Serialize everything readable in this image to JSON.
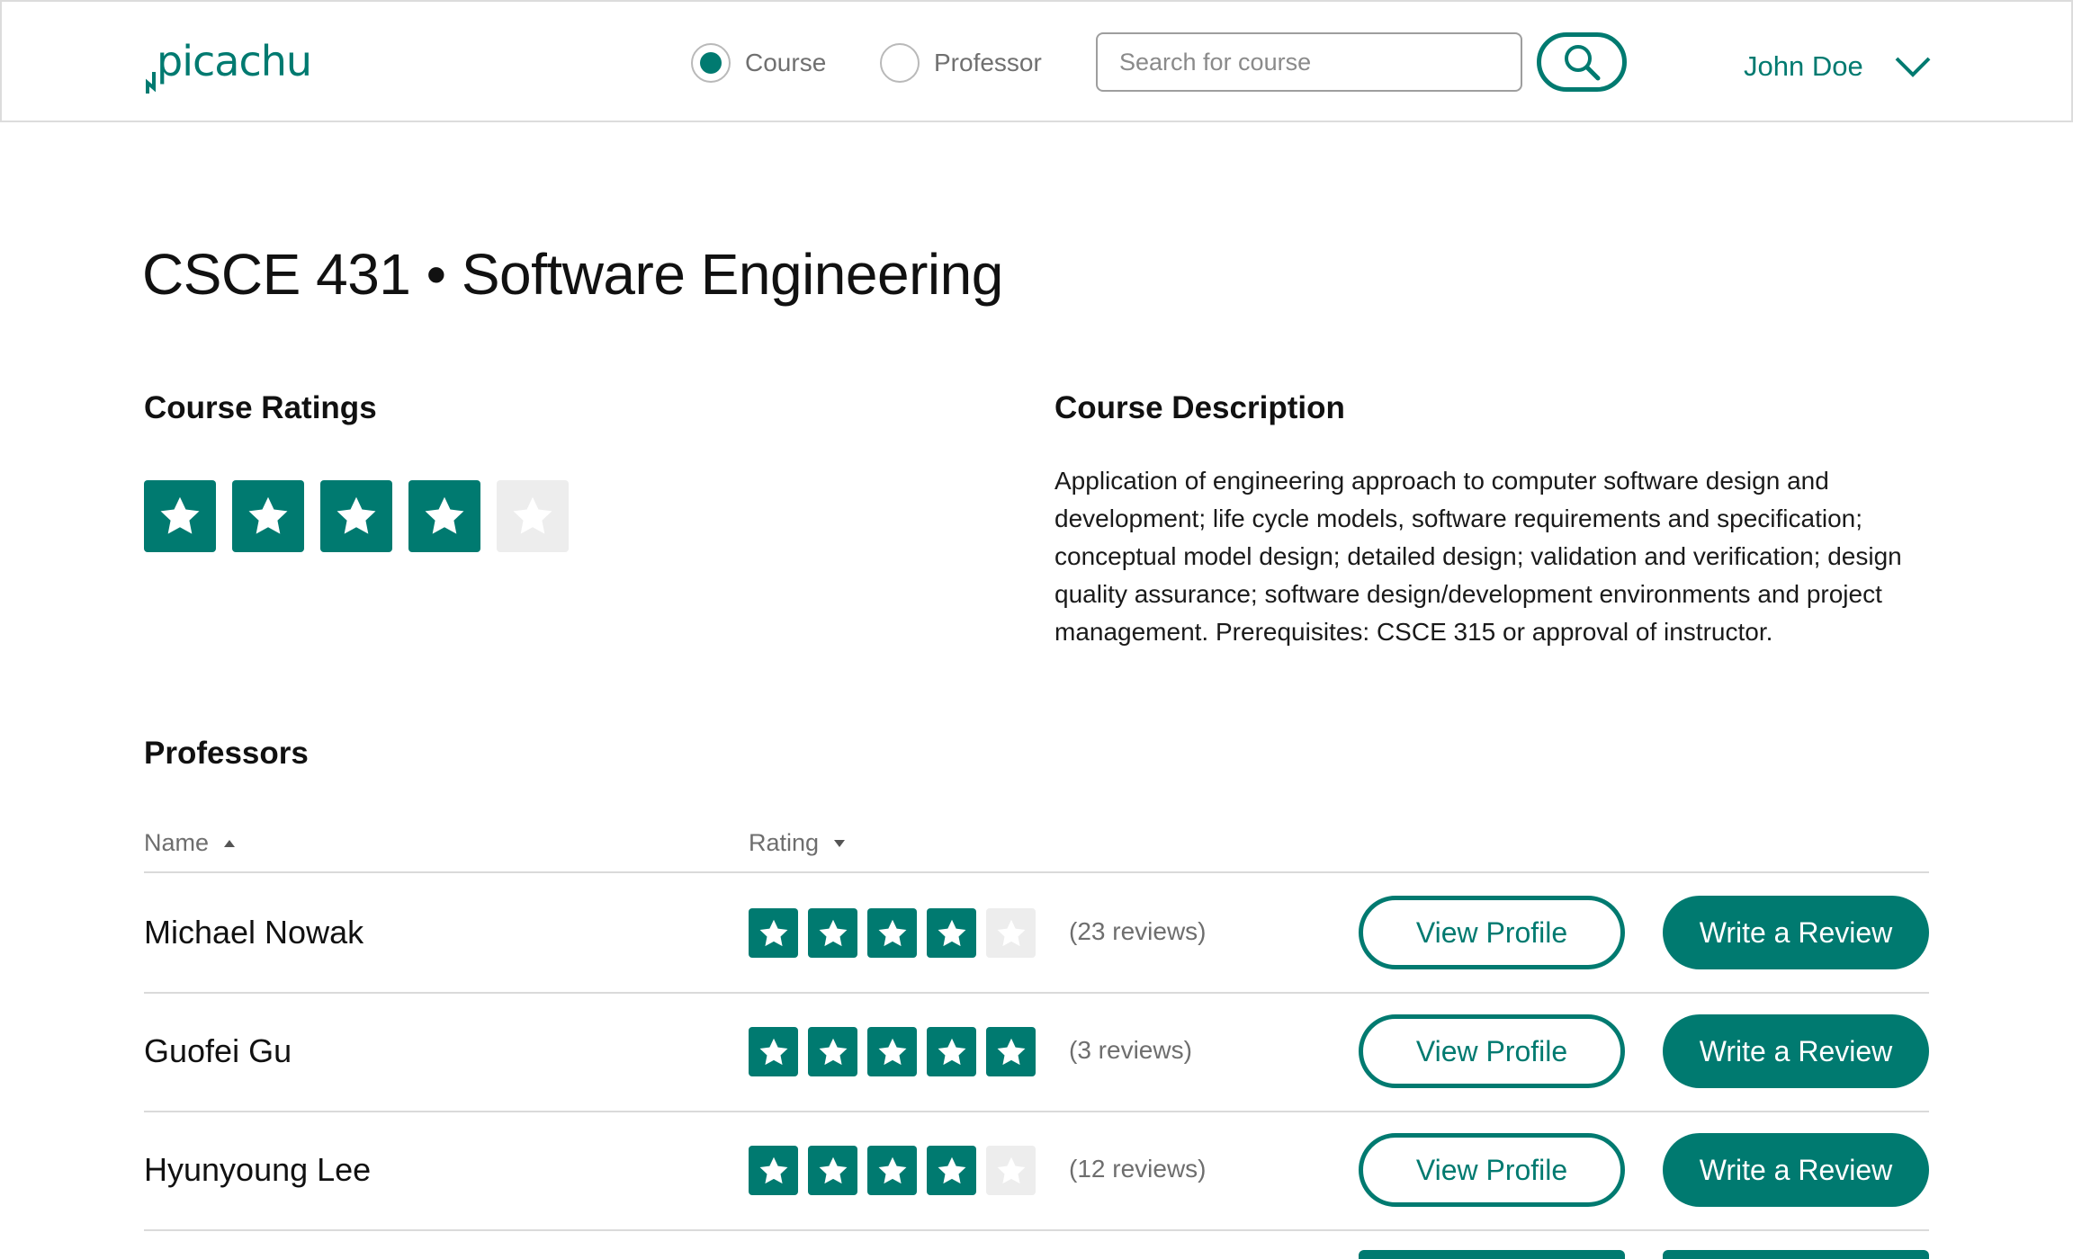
{
  "app": {
    "logo_text": "picachu"
  },
  "header": {
    "search_modes": [
      {
        "label": "Course",
        "selected": true
      },
      {
        "label": "Professor",
        "selected": false
      }
    ],
    "search_placeholder": "Search for course",
    "search_button_icon": "search-icon",
    "user": {
      "name": "John Doe",
      "menu_icon": "chevron-down-icon"
    }
  },
  "course": {
    "title": "CSCE 431 • Software Engineering",
    "ratings_heading": "Course Ratings",
    "rating": 4,
    "rating_max": 5,
    "description_heading": "Course Description",
    "description": "Application of engineering approach to computer software design and development; life cycle models, software requirements and specification; conceptual model design; detailed design; validation and verification; design quality assurance; software design/development environments and project management. Prerequisites: CSCE 315 or approval of instructor."
  },
  "professors": {
    "heading": "Professors",
    "columns": {
      "name": "Name",
      "rating": "Rating"
    },
    "sort": {
      "name": "ascending",
      "rating": "descending"
    },
    "rows": [
      {
        "name": "Michael Nowak",
        "rating": 4,
        "reviews": "(23 reviews)",
        "view_label": "View Profile",
        "review_label": "Write a Review"
      },
      {
        "name": "Guofei Gu",
        "rating": 5,
        "reviews": "(3 reviews)",
        "view_label": "View Profile",
        "review_label": "Write a Review"
      },
      {
        "name": "Hyunyoung Lee",
        "rating": 4,
        "reviews": "(12 reviews)",
        "view_label": "View Profile",
        "review_label": "Write a Review"
      }
    ]
  },
  "colors": {
    "accent": "#007a70",
    "star_off": "#ededed",
    "muted_text": "#6e6e6e",
    "divider": "#dadada"
  }
}
